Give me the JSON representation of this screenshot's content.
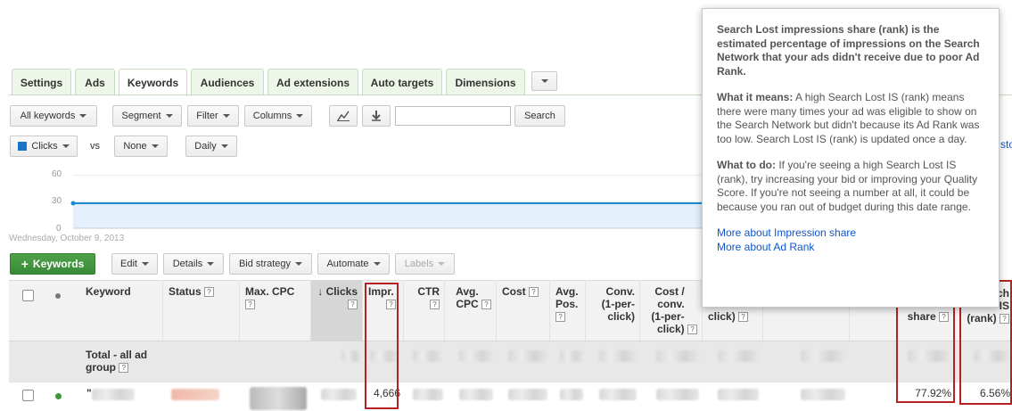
{
  "tabs": [
    {
      "label": "Settings"
    },
    {
      "label": "Ads"
    },
    {
      "label": "Keywords"
    },
    {
      "label": "Audiences"
    },
    {
      "label": "Ad extensions"
    },
    {
      "label": "Auto targets"
    },
    {
      "label": "Dimensions"
    }
  ],
  "toolbar": {
    "all_keywords": "All keywords",
    "segment": "Segment",
    "filter": "Filter",
    "columns": "Columns",
    "search_button": "Search"
  },
  "chart_controls": {
    "metric1": "Clicks",
    "vs": "vs",
    "metric2": "None",
    "granularity": "Daily",
    "metric1_color": "#1a73c9"
  },
  "chart_data": {
    "type": "line",
    "series": [
      {
        "name": "Clicks",
        "values": [
          28,
          28
        ]
      }
    ],
    "yticks": [
      "60",
      "30",
      "0"
    ],
    "ylim": [
      0,
      60
    ],
    "xlabel_date": "Wednesday, October 9, 2013"
  },
  "actions": {
    "add_keywords": "Keywords",
    "edit": "Edit",
    "details": "Details",
    "bid_strategy": "Bid strategy",
    "automate": "Automate",
    "labels": "Labels"
  },
  "table": {
    "headers": {
      "keyword": "Keyword",
      "status": "Status",
      "max_cpc": "Max. CPC",
      "clicks": "Clicks",
      "impr": "Impr.",
      "ctr": "CTR",
      "avg_cpc": "Avg. CPC",
      "cost": "Cost",
      "avg_pos": "Avg. Pos.",
      "conv": "Conv. (1-per-click)",
      "cost_conv": "Cost / conv. (1-per-click)",
      "conv_rate": "click)",
      "share": "share",
      "rank": "(rank)",
      "rank_top": "ch",
      "rank_is": "IS"
    },
    "help_mark": "?",
    "total_label": "Total - all ad group",
    "row1": {
      "keyword": "\"",
      "impressions": "4,666",
      "share": "77.92%",
      "rank": "6.56%"
    }
  },
  "popup": {
    "title": "Search Lost impressions share (rank) is the estimated percentage of impressions on the Search Network that your ads didn't receive due to poor Ad Rank.",
    "what_it_means_label": "What it means:",
    "what_it_means": " A high Search Lost IS (rank) means there were many times your ad was eligible to show on the Search Network but didn't because its Ad Rank was too low. Search Lost IS (rank) is updated once a day.",
    "what_to_do_label": "What to do:",
    "what_to_do": " If you're seeing a high Search Lost IS (rank), try increasing your bid or improving your Quality Score. If you're not seeing a number at all, it could be because you ran out of budget during this date range.",
    "link1": "More about Impression share",
    "link2": "More about Ad Rank"
  },
  "edge_text": "sto"
}
